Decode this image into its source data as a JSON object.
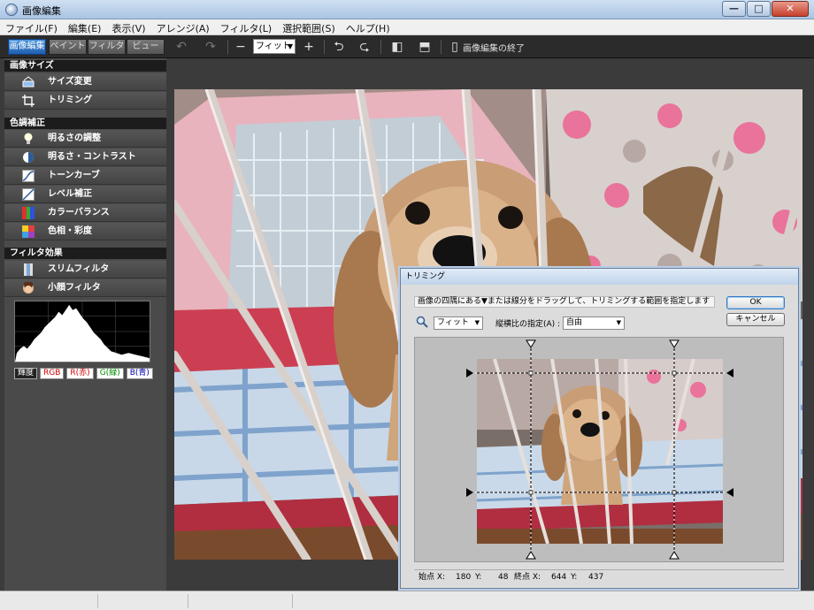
{
  "window": {
    "title": "画像編集"
  },
  "menu": [
    "ファイル(F)",
    "編集(E)",
    "表示(V)",
    "アレンジ(A)",
    "フィルタ(L)",
    "選択範囲(S)",
    "ヘルプ(H)"
  ],
  "modes": [
    {
      "label": "画像編集",
      "active": true
    },
    {
      "label": "ペイント",
      "active": false
    },
    {
      "label": "フィルタ",
      "active": false
    },
    {
      "label": "ビュー",
      "active": false
    }
  ],
  "toolbar": {
    "zoom_value": "フィット",
    "exit_label": "画像編集の終了"
  },
  "sidebar": {
    "sections": [
      {
        "title": "画像サイズ",
        "items": [
          "サイズ変更",
          "トリミング"
        ]
      },
      {
        "title": "色調補正",
        "items": [
          "明るさの調整",
          "明るさ・コントラスト",
          "トーンカーブ",
          "レベル補正",
          "カラーバランス",
          "色相・彩度"
        ]
      },
      {
        "title": "フィルタ効果",
        "items": [
          "スリムフィルタ",
          "小顔フィルタ"
        ]
      }
    ],
    "channels": [
      "輝度",
      "RGB",
      "R(赤)",
      "G(緑)",
      "B(青)"
    ]
  },
  "dialog": {
    "title": "トリミング",
    "message": "画像の四隅にある▼または線分をドラッグして、トリミングする範囲を指定します",
    "ok_label": "OK",
    "cancel_label": "キャンセル",
    "zoom_value": "フィット",
    "aspect_label": "縦横比の指定(A) :",
    "aspect_value": "自由",
    "start_label": "始点 X:",
    "start_x": "180",
    "start_y_label": "Y:",
    "start_y": "48",
    "end_label": "終点 X:",
    "end_x": "644",
    "end_y_label": "Y:",
    "end_y": "437"
  }
}
